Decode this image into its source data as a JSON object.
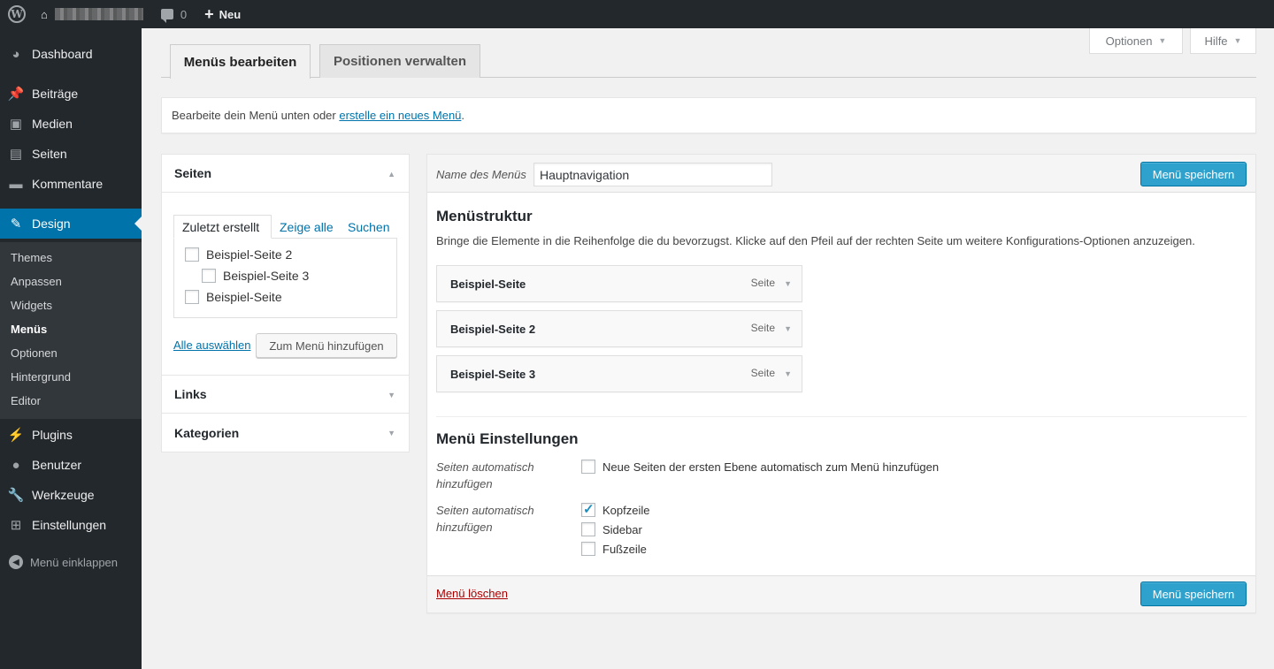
{
  "adminbar": {
    "comment_count": "0",
    "new_label": "Neu"
  },
  "sidebar": {
    "items": [
      {
        "label": "Dashboard",
        "icon": "dashboard-icon"
      },
      {
        "label": "Beiträge",
        "icon": "pushpin-icon"
      },
      {
        "label": "Medien",
        "icon": "media-icon"
      },
      {
        "label": "Seiten",
        "icon": "pages-icon"
      },
      {
        "label": "Kommentare",
        "icon": "comment-icon"
      },
      {
        "label": "Design",
        "icon": "brush-icon"
      },
      {
        "label": "Plugins",
        "icon": "plug-icon"
      },
      {
        "label": "Benutzer",
        "icon": "user-icon"
      },
      {
        "label": "Werkzeuge",
        "icon": "wrench-icon"
      },
      {
        "label": "Einstellungen",
        "icon": "settings-icon"
      }
    ],
    "submenu": [
      "Themes",
      "Anpassen",
      "Widgets",
      "Menüs",
      "Optionen",
      "Hintergrund",
      "Editor"
    ],
    "collapse_label": "Menü einklappen"
  },
  "screen_meta": {
    "options_label": "Optionen",
    "help_label": "Hilfe"
  },
  "tabs": {
    "edit_label": "Menüs bearbeiten",
    "locations_label": "Positionen verwalten"
  },
  "notice": {
    "text": "Bearbeite dein Menü unten oder ",
    "link": "erstelle ein neues Menü",
    "suffix": "."
  },
  "left_panel": {
    "pages_title": "Seiten",
    "subtabs": [
      "Zuletzt erstellt",
      "Zeige alle",
      "Suchen"
    ],
    "pages": [
      "Beispiel-Seite 2",
      "Beispiel-Seite 3",
      "Beispiel-Seite"
    ],
    "select_all": "Alle auswählen",
    "add_button": "Zum Menü hinzufügen",
    "links_title": "Links",
    "categories_title": "Kategorien"
  },
  "menu": {
    "name_label": "Name des Menüs",
    "name_value": "Hauptnavigation",
    "save_label": "Menü speichern",
    "structure_title": "Menüstruktur",
    "structure_desc": "Bringe die Elemente in die Reihenfolge die du bevorzugst. Klicke auf den Pfeil auf der rechten Seite um weitere Konfigurations-Optionen anzuzeigen.",
    "items": [
      {
        "title": "Beispiel-Seite",
        "type": "Seite"
      },
      {
        "title": "Beispiel-Seite 2",
        "type": "Seite"
      },
      {
        "title": "Beispiel-Seite 3",
        "type": "Seite"
      }
    ],
    "settings_title": "Menü Einstellungen",
    "auto_add_label_1": "Seiten automatisch",
    "auto_add_label_2": "hinzufügen",
    "auto_add_option": "Neue Seiten der ersten Ebene automatisch zum Menü hinzufügen",
    "locations_label_1": "Seiten automatisch",
    "locations_label_2": "hinzufügen",
    "locations": [
      {
        "label": "Kopfzeile",
        "checked": true
      },
      {
        "label": "Sidebar",
        "checked": false
      },
      {
        "label": "Fußzeile",
        "checked": false
      }
    ],
    "delete_label": "Menü löschen"
  },
  "colors": {
    "accent": "#0073aa",
    "primary_button": "#2ea2cc",
    "sidebar_bg": "#23282d",
    "delete": "#aa0000"
  }
}
